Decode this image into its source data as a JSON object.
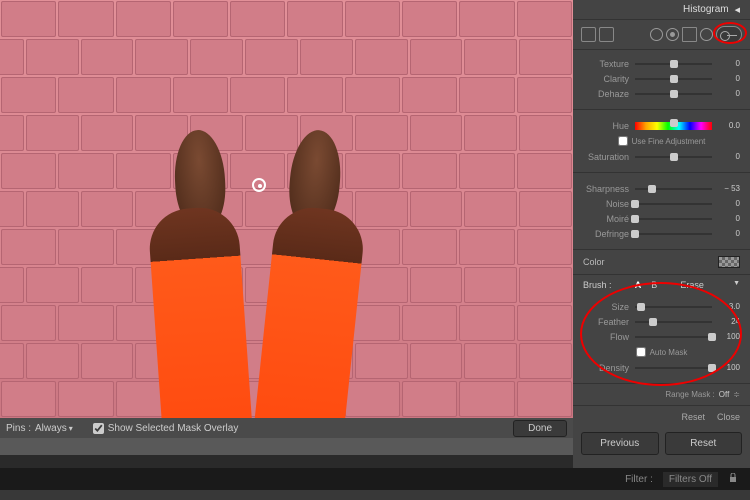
{
  "histogram": {
    "title": "Histogram"
  },
  "preview": {
    "pins_label": "Pins :",
    "pins_value": "Always",
    "overlay_label": "Show Selected Mask Overlay",
    "done": "Done"
  },
  "sliders": {
    "texture": {
      "label": "Texture",
      "value": 0,
      "pos": 50
    },
    "clarity": {
      "label": "Clarity",
      "value": 0,
      "pos": 50
    },
    "dehaze": {
      "label": "Dehaze",
      "value": 0,
      "pos": 50
    },
    "hue": {
      "label": "Hue",
      "value": "0.0",
      "pos": 50
    },
    "fine_adjust": "Use Fine Adjustment",
    "saturation": {
      "label": "Saturation",
      "value": 0,
      "pos": 50
    },
    "sharpness": {
      "label": "Sharpness",
      "value": "− 53",
      "pos": 22
    },
    "noise": {
      "label": "Noise",
      "value": 0,
      "pos": 0
    },
    "moire": {
      "label": "Moiré",
      "value": 0,
      "pos": 0
    },
    "defringe": {
      "label": "Defringe",
      "value": 0,
      "pos": 0
    },
    "color": "Color"
  },
  "brush": {
    "header": "Brush :",
    "tab_a": "A",
    "tab_b": "B",
    "erase": "Erase",
    "size": {
      "label": "Size",
      "value": "3.0",
      "pos": 8
    },
    "feather": {
      "label": "Feather",
      "value": 24,
      "pos": 24
    },
    "flow": {
      "label": "Flow",
      "value": 100,
      "pos": 100
    },
    "auto_mask": "Auto Mask",
    "density": {
      "label": "Density",
      "value": 100,
      "pos": 100
    }
  },
  "range_mask": {
    "label": "Range Mask :",
    "value": "Off"
  },
  "reset_close": {
    "reset": "Reset",
    "close": "Close"
  },
  "bottom_buttons": {
    "previous": "Previous",
    "reset": "Reset"
  },
  "filter": {
    "label": "Filter :",
    "value": "Filters Off"
  }
}
